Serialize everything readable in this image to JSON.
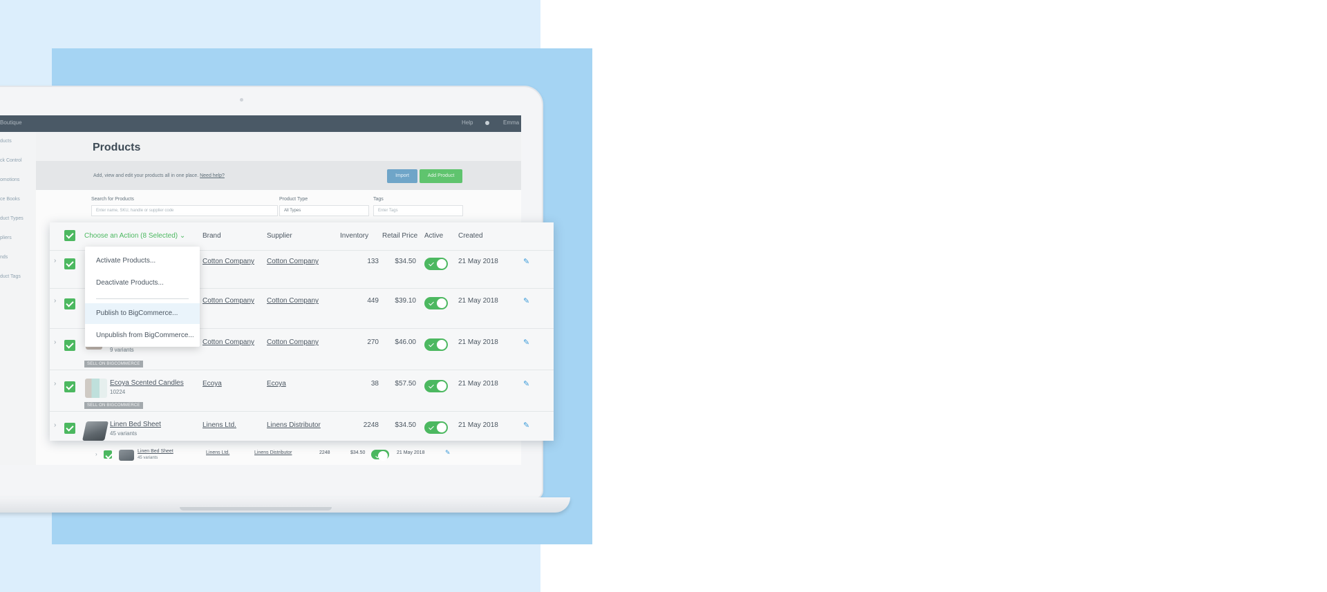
{
  "colors": {
    "bg_light": "#dceefc",
    "bg_blue": "#a5d4f3",
    "accent_green": "#4cb860",
    "edit_blue": "#3a9ad9"
  },
  "app": {
    "brand": "Boutique",
    "help": "Help",
    "user": "Emma",
    "sidebar": [
      "ducts",
      "ck Control",
      "omotions",
      "ce Books",
      "duct Types",
      "pliers",
      "nds",
      "duct Tags"
    ],
    "page_title": "Products",
    "subtitle": "Add, view and edit your products all in one place.",
    "subtitle_link": "Need help?",
    "import_button": "Import",
    "add_product_button": "Add Product",
    "filters": {
      "search_label": "Search for Products",
      "search_placeholder": "Enter name, SKU, handle or supplier code",
      "type_label": "Product Type",
      "type_value": "All Types",
      "tags_label": "Tags",
      "tags_placeholder": "Enter Tags"
    },
    "background_row": {
      "name": "Linen Bed Sheet",
      "variants": "45 variants",
      "brand": "Linens Ltd.",
      "supplier": "Linens Distributor",
      "inventory": "2248",
      "price": "$34.50",
      "created": "21 May 2018"
    }
  },
  "table": {
    "action_label": "Choose an Action (8 Selected)",
    "action_chevron": "⌄",
    "columns": {
      "brand": "Brand",
      "supplier": "Supplier",
      "inventory": "Inventory",
      "retail_price": "Retail Price",
      "active": "Active",
      "created": "Created"
    },
    "rows": [
      {
        "name": "",
        "sub": "",
        "badge": "",
        "brand": "Cotton Company",
        "supplier": "Cotton Company",
        "inventory": "133",
        "price": "$34.50",
        "active": true,
        "created": "21 May 2018"
      },
      {
        "name": "",
        "sub": "",
        "badge": "",
        "brand": "Cotton Company",
        "supplier": "Cotton Company",
        "inventory": "449",
        "price": "$39.10",
        "active": true,
        "created": "21 May 2018"
      },
      {
        "name": "",
        "sub": "9 variants",
        "badge": "SELL ON BIGCOMMERCE",
        "brand": "Cotton Company",
        "supplier": "Cotton Company",
        "inventory": "270",
        "price": "$46.00",
        "active": true,
        "created": "21 May 2018"
      },
      {
        "name": "Ecoya Scented Candles",
        "sub": "10224",
        "badge": "SELL ON BIGCOMMERCE",
        "brand": "Ecoya",
        "supplier": "Ecoya",
        "inventory": "38",
        "price": "$57.50",
        "active": true,
        "created": "21 May 2018"
      },
      {
        "name": "Linen Bed Sheet",
        "sub": "45 variants",
        "badge": "",
        "brand": "Linens Ltd.",
        "supplier": "Linens Distributor",
        "inventory": "2248",
        "price": "$34.50",
        "active": true,
        "created": "21 May 2018"
      }
    ]
  },
  "menu": {
    "items": [
      "Activate Products...",
      "Deactivate Products...",
      "Publish to BigCommerce...",
      "Unpublish from BigCommerce..."
    ],
    "highlighted_index": 2
  },
  "icons": {
    "row_expand": "›",
    "edit": "✎"
  }
}
